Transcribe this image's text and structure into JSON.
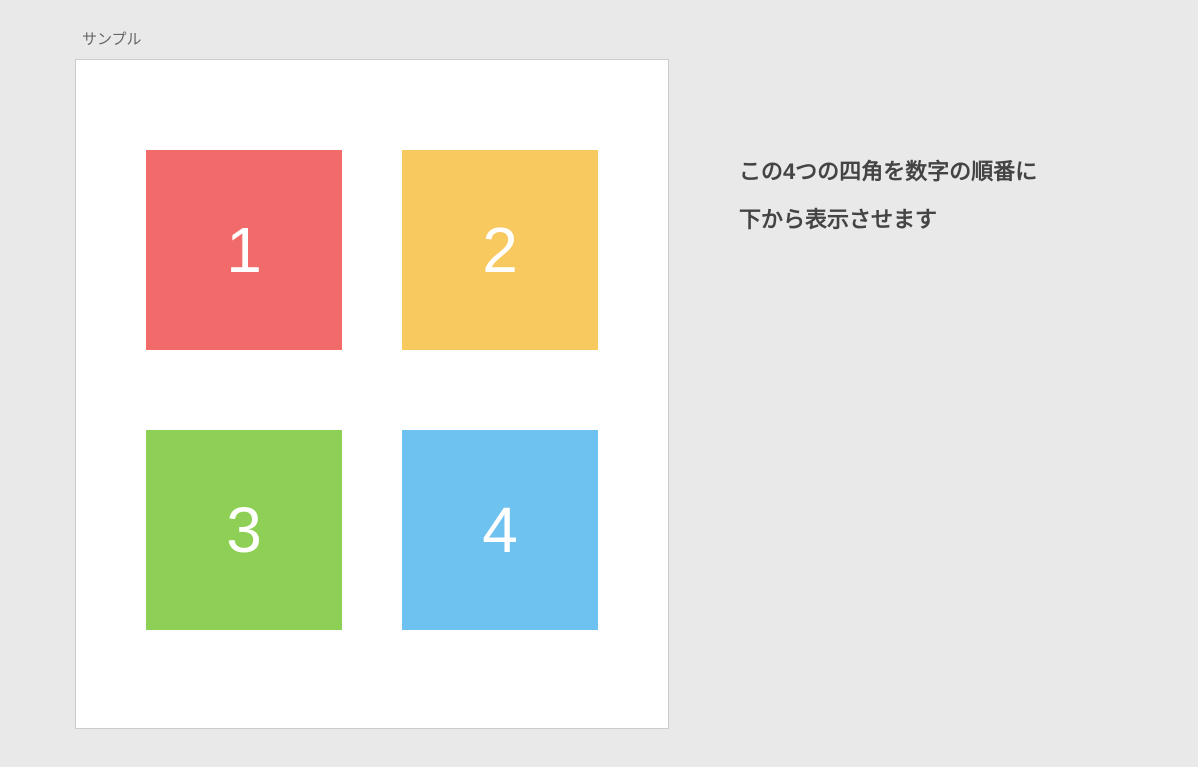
{
  "label": "サンプル",
  "boxes": {
    "b1": "1",
    "b2": "2",
    "b3": "3",
    "b4": "4"
  },
  "colors": {
    "b1": "#f26b6b",
    "b2": "#f7c95e",
    "b3": "#8ecf55",
    "b4": "#6dc2ef"
  },
  "description": {
    "line1": "この4つの四角を数字の順番に",
    "line2": "下から表示させます"
  }
}
